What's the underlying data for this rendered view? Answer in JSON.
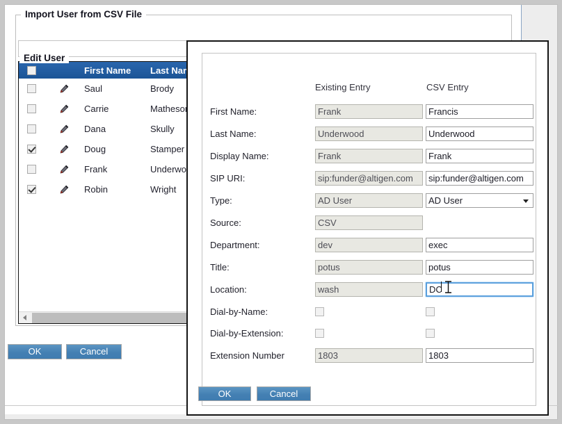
{
  "import_panel": {
    "legend": "Import User from CSV File",
    "filter_placeholder": "",
    "filter_value": "",
    "grid": {
      "columns": [
        "",
        "",
        "First Name",
        "Last Name"
      ],
      "header_select_all_checked": false,
      "rows": [
        {
          "checked": false,
          "first_name": "Saul",
          "last_name": "Brody"
        },
        {
          "checked": false,
          "first_name": "Carrie",
          "last_name": "Matheson"
        },
        {
          "checked": false,
          "first_name": "Dana",
          "last_name": "Skully"
        },
        {
          "checked": true,
          "first_name": "Doug",
          "last_name": "Stamper"
        },
        {
          "checked": false,
          "first_name": "Frank",
          "last_name": "Underwood"
        },
        {
          "checked": true,
          "first_name": "Robin",
          "last_name": "Wright"
        }
      ]
    },
    "ok_label": "OK",
    "cancel_label": "Cancel"
  },
  "edit_dialog": {
    "legend": "Edit User",
    "column_headers": {
      "existing": "Existing Entry",
      "csv": "CSV Entry"
    },
    "fields": [
      {
        "label": "First Name:",
        "existing": "Frank",
        "csv": "Francis"
      },
      {
        "label": "Last Name:",
        "existing": "Underwood",
        "csv": "Underwood"
      },
      {
        "label": "Display Name:",
        "existing": "Frank",
        "csv": "Frank"
      },
      {
        "label": "SIP URI:",
        "existing": "sip:funder@altigen.com",
        "csv": "sip:funder@altigen.com"
      },
      {
        "label": "Type:",
        "existing": "AD User",
        "csv": "AD User"
      },
      {
        "label": "Source:",
        "existing": "CSV",
        "csv": null
      },
      {
        "label": "Department:",
        "existing": "dev",
        "csv": "exec"
      },
      {
        "label": "Title:",
        "existing": "potus",
        "csv": "potus"
      },
      {
        "label": "Location:",
        "existing": "wash",
        "csv": "DC"
      },
      {
        "label": "Dial-by-Name:",
        "existing": false,
        "csv": false
      },
      {
        "label": "Dial-by-Extension:",
        "existing": false,
        "csv": false
      },
      {
        "label": "Extension Number",
        "existing": "1803",
        "csv": "1803"
      }
    ],
    "type_options": [
      "AD User"
    ],
    "ok_label": "OK",
    "cancel_label": "Cancel"
  },
  "colors": {
    "header_blue": "#1b5496",
    "button_blue": "#4480b3",
    "focus_blue": "#5ba0dd",
    "readonly_bg": "#e8e8e2"
  }
}
